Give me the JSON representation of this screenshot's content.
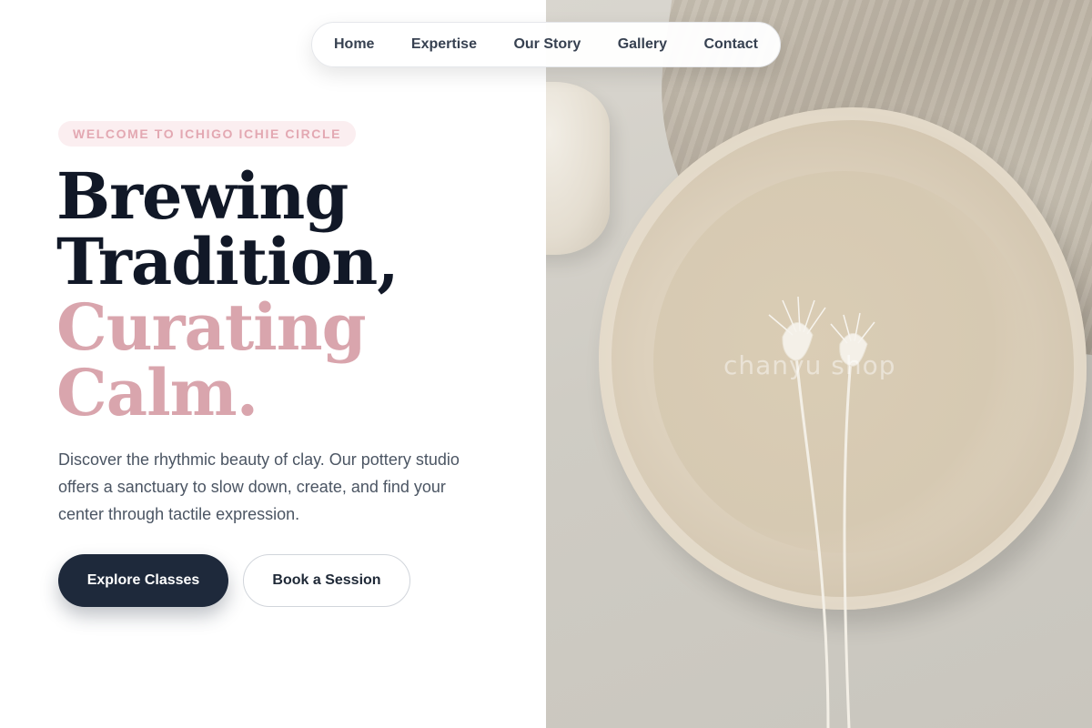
{
  "nav": {
    "items": [
      "Home",
      "Expertise",
      "Our Story",
      "Gallery",
      "Contact"
    ]
  },
  "hero": {
    "eyebrow": "WELCOME TO ICHIGO ICHIE CIRCLE",
    "headline": {
      "line1": "Brewing",
      "line2": "Tradition,",
      "line3": "Curating",
      "line4": "Calm."
    },
    "lead": "Discover the rhythmic beauty of clay. Our pottery studio offers a sanctuary to slow down, create, and find your center through tactile expression.",
    "primary_button": "Explore Classes",
    "secondary_button": "Book a Session"
  },
  "image": {
    "watermark": "chanyu shop",
    "subject": "ceramic plate with dried flowers on linen"
  },
  "colors": {
    "primary_dark": "#1e293b",
    "headline_dark": "#111827",
    "accent_pink": "#d9a5ad",
    "eyebrow_bg": "#fbeef0",
    "eyebrow_text": "#e3a8b2",
    "body_text": "#4b5563"
  }
}
